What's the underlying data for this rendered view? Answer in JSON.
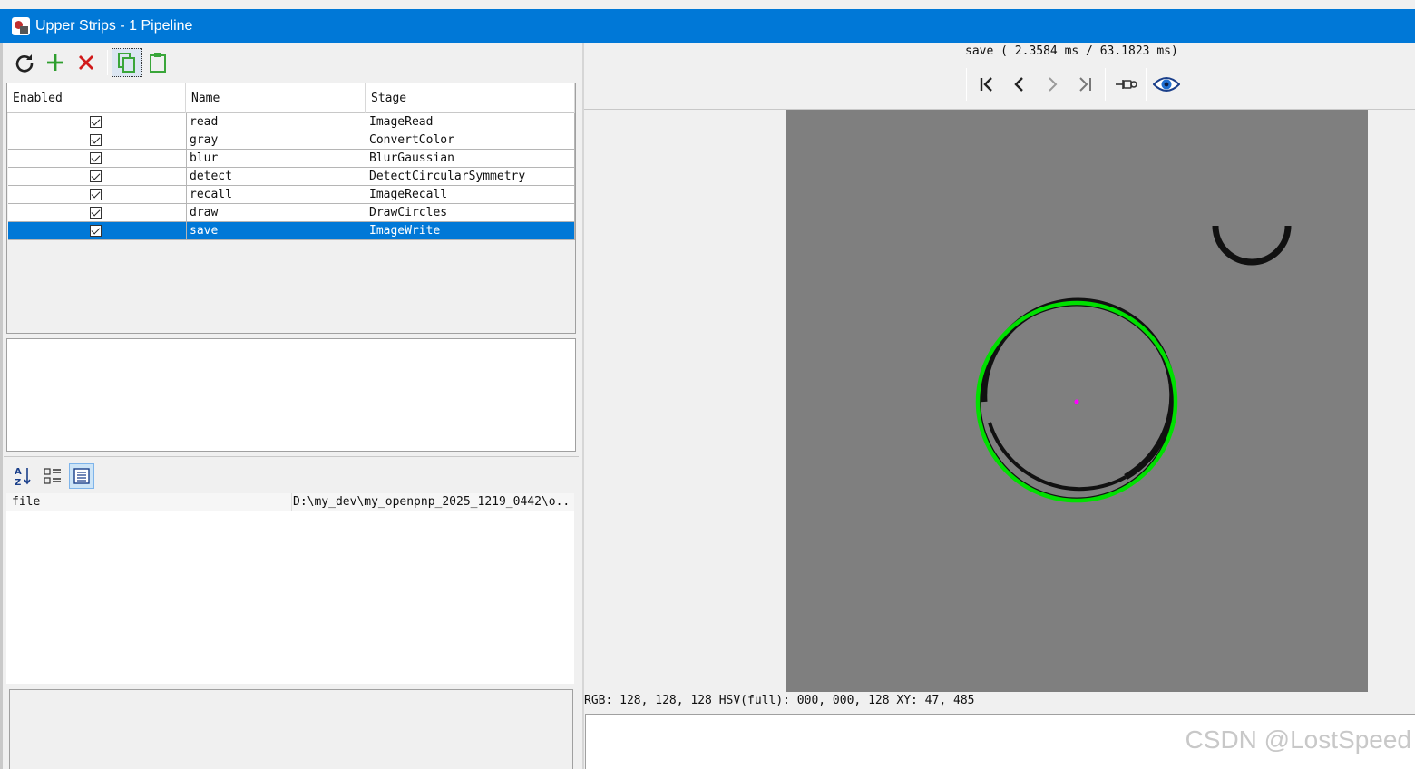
{
  "window": {
    "title": "Upper Strips - 1 Pipeline"
  },
  "toolbar": {
    "items": [
      {
        "name": "refresh-icon",
        "color": "#222222"
      },
      {
        "name": "add-icon",
        "color": "#2e9e2e"
      },
      {
        "name": "delete-icon",
        "color": "#d11a1a"
      },
      {
        "name": "copy-icon",
        "color": "#3aa63a"
      },
      {
        "name": "paste-icon",
        "color": "#3aa63a"
      }
    ]
  },
  "table": {
    "headers": {
      "enabled": "Enabled",
      "name": "Name",
      "stage": "Stage"
    },
    "rows": [
      {
        "enabled": true,
        "name": "read",
        "stage": "ImageRead"
      },
      {
        "enabled": true,
        "name": "gray",
        "stage": "ConvertColor"
      },
      {
        "enabled": true,
        "name": "blur",
        "stage": "BlurGaussian"
      },
      {
        "enabled": true,
        "name": "detect",
        "stage": "DetectCircularSymmetry"
      },
      {
        "enabled": true,
        "name": "recall",
        "stage": "ImageRecall"
      },
      {
        "enabled": true,
        "name": "draw",
        "stage": "DrawCircles"
      },
      {
        "enabled": true,
        "name": "save",
        "stage": "ImageWrite",
        "selected": true
      }
    ]
  },
  "properties": {
    "rows": [
      {
        "key": "file",
        "value": "D:\\my_dev\\my_openpnp_2025_1219_0442\\o.."
      }
    ]
  },
  "viewer": {
    "status": "save ( 2.3584 ms / 63.1823 ms)",
    "pixel_readout": "RGB: 128, 128, 128 HSV(full): 000, 000, 128 XY: 47, 485",
    "colors": {
      "background": "#7f7f7f",
      "circle": "#00e000",
      "center": "#ff00ff"
    }
  },
  "watermark": "CSDN @LostSpeed"
}
